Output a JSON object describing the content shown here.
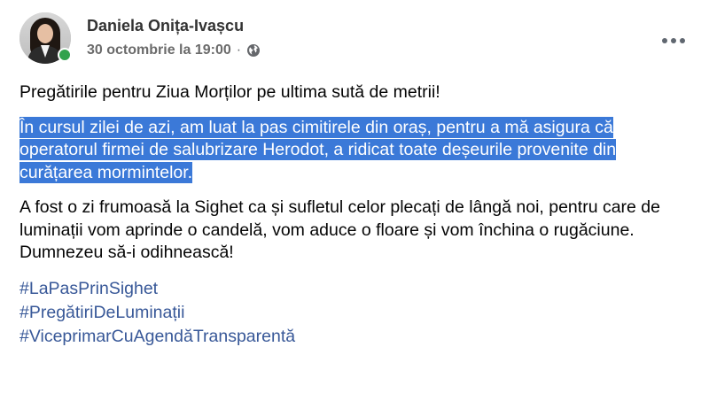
{
  "post": {
    "author": {
      "name": "Daniela Onița-Ivașcu",
      "avatar_icon": "profile-photo",
      "online_status_color": "#31a24c"
    },
    "timestamp": "30 octombrie la 19:00",
    "separator": "·",
    "privacy_icon": "globe-icon",
    "more_icon": "three-dots-icon",
    "paragraphs": [
      {
        "text": "Pregătirile pentru Ziua Morților pe ultima sută de metrii!",
        "highlighted": false
      },
      {
        "text": "În cursul zilei de azi, am luat la pas cimitirele din oraș, pentru a mă asigura că operatorul firmei de salubrizare Herodot, a ridicat toate deșeurile provenite din curățarea mormintelor.",
        "highlighted": true
      },
      {
        "text": "A fost o zi frumoasă la Sighet ca și sufletul celor plecați de lângă noi, pentru care de luminații vom aprinde o candelă, vom aduce o floare și vom închina o rugăciune. Dumnezeu să-i odihnească!",
        "highlighted": false
      }
    ],
    "hashtags": [
      "#LaPasPrinSighet",
      "#PregătiriDeLuminații",
      "#ViceprimarCuAgendăTransparentă"
    ]
  },
  "colors": {
    "highlight_background": "#3b79d8",
    "hashtag_link": "#385898",
    "secondary_text": "#65676b"
  }
}
